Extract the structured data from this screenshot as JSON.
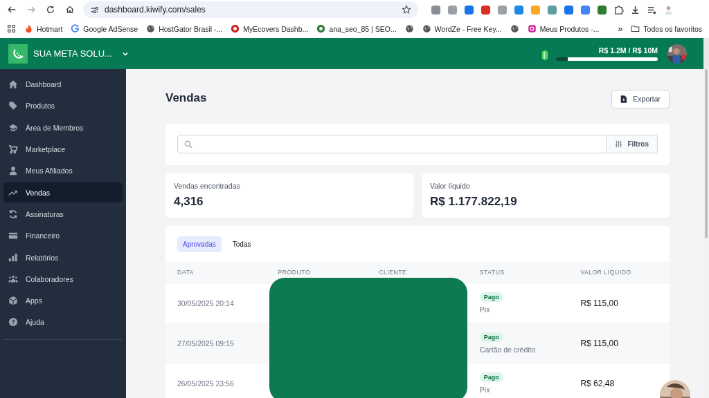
{
  "browser": {
    "url": "dashboard.kiwify.com/sales",
    "bookmarks": [
      {
        "label": "Hotmart"
      },
      {
        "label": "Google AdSense"
      },
      {
        "label": "HostGator Brasil -..."
      },
      {
        "label": "MyEcovers Dashb..."
      },
      {
        "label": "ana_seo_85 | SEO..."
      },
      {
        "label": "WordZe - Free Key..."
      },
      {
        "label": "Meus Produtos -..."
      }
    ],
    "more": "»",
    "folder": "Todos os favoritos"
  },
  "header": {
    "org": "SUA META SOLU...",
    "goal": "R$ 1.2M / R$ 10M",
    "level": 0.12
  },
  "sidebar": {
    "items": [
      {
        "label": "Dashboard",
        "selected": false
      },
      {
        "label": "Produtos",
        "selected": false
      },
      {
        "label": "Área de Membros",
        "selected": false
      },
      {
        "label": "Marketplace",
        "selected": false
      },
      {
        "label": "Meus Afiliados",
        "selected": false
      },
      {
        "label": "Vendas",
        "selected": true
      },
      {
        "label": "Assinaturas",
        "selected": false
      },
      {
        "label": "Financeiro",
        "selected": false
      },
      {
        "label": "Relatórios",
        "selected": false
      },
      {
        "label": "Colaboradores",
        "selected": false
      },
      {
        "label": "Apps",
        "selected": false
      },
      {
        "label": "Ajuda",
        "selected": false
      }
    ]
  },
  "page": {
    "title": "Vendas",
    "export": "Exportar",
    "filters": "Filtros"
  },
  "stats": [
    {
      "label": "Vendas encontradas",
      "value": "4,316"
    },
    {
      "label": "Valor líquido",
      "value": "R$ 1.177.822,19"
    }
  ],
  "tabs": [
    {
      "label": "Aprovadas",
      "selected": true
    },
    {
      "label": "Todas",
      "selected": false
    }
  ],
  "table": {
    "columns": [
      "DATA",
      "PRODUTO",
      "CLIENTE",
      "STATUS",
      "VALOR LÍQUIDO"
    ],
    "rows": [
      {
        "date": "30/05/2025 20:14",
        "status": "Pago",
        "method": "Pix",
        "value": "R$ 115,00"
      },
      {
        "date": "27/05/2025 09:15",
        "status": "Pago",
        "method": "Cartão de crédito",
        "value": "R$ 115,00"
      },
      {
        "date": "26/05/2025 23:56",
        "status": "Pago",
        "method": "Pix",
        "value": "R$ 62,48"
      }
    ]
  }
}
